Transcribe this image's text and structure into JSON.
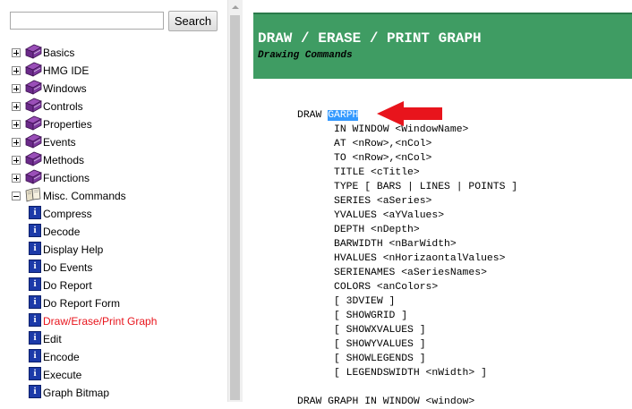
{
  "search": {
    "placeholder": "",
    "value": "",
    "button_label": "Search"
  },
  "tree": {
    "top_items": [
      {
        "label": "Basics"
      },
      {
        "label": "HMG IDE"
      },
      {
        "label": "Windows"
      },
      {
        "label": "Controls"
      },
      {
        "label": "Properties"
      },
      {
        "label": "Events"
      },
      {
        "label": "Methods"
      },
      {
        "label": "Functions"
      },
      {
        "label": "Misc. Commands"
      }
    ],
    "misc_items": [
      {
        "label": "Compress"
      },
      {
        "label": "Decode"
      },
      {
        "label": "Display Help"
      },
      {
        "label": "Do Events"
      },
      {
        "label": "Do Report"
      },
      {
        "label": "Do Report Form"
      },
      {
        "label": "Draw/Erase/Print Graph"
      },
      {
        "label": "Edit"
      },
      {
        "label": "Encode"
      },
      {
        "label": "Execute"
      },
      {
        "label": "Graph Bitmap"
      }
    ],
    "active_item": "Draw/Erase/Print Graph"
  },
  "content": {
    "title": "DRAW / ERASE / PRINT GRAPH",
    "subtitle": "Drawing Commands",
    "code_first_prefix": "DRAW ",
    "code_highlight": "GARPH",
    "code_lines": [
      "      IN WINDOW <WindowName>",
      "      AT <nRow>,<nCol>",
      "      TO <nRow>,<nCol>",
      "      TITLE <cTitle>",
      "      TYPE [ BARS | LINES | POINTS ]",
      "      SERIES <aSeries>",
      "      YVALUES <aYValues>",
      "      DEPTH <nDepth>",
      "      BARWIDTH <nBarWidth>",
      "      HVALUES <nHorizaontalValues>",
      "      SERIENAMES <aSeriesNames>",
      "      COLORS <anColors>",
      "      [ 3DVIEW ]",
      "      [ SHOWGRID ]",
      "      [ SHOWXVALUES ]",
      "      [ SHOWYVALUES ]",
      "      [ SHOWLEGENDS ]",
      "      [ LEGENDSWIDTH <nWidth> ]",
      "",
      "DRAW GRAPH IN WINDOW <window>"
    ]
  },
  "colors": {
    "banner": "#3f9c63",
    "active_link": "#e8141c",
    "highlight": "#3399ff",
    "arrow": "#e8141c"
  },
  "icons": {
    "folder": "purple-book-icon",
    "folder_open": "open-book-icon",
    "topic": "help-topic-icon",
    "pointer": "red-arrow-icon"
  }
}
